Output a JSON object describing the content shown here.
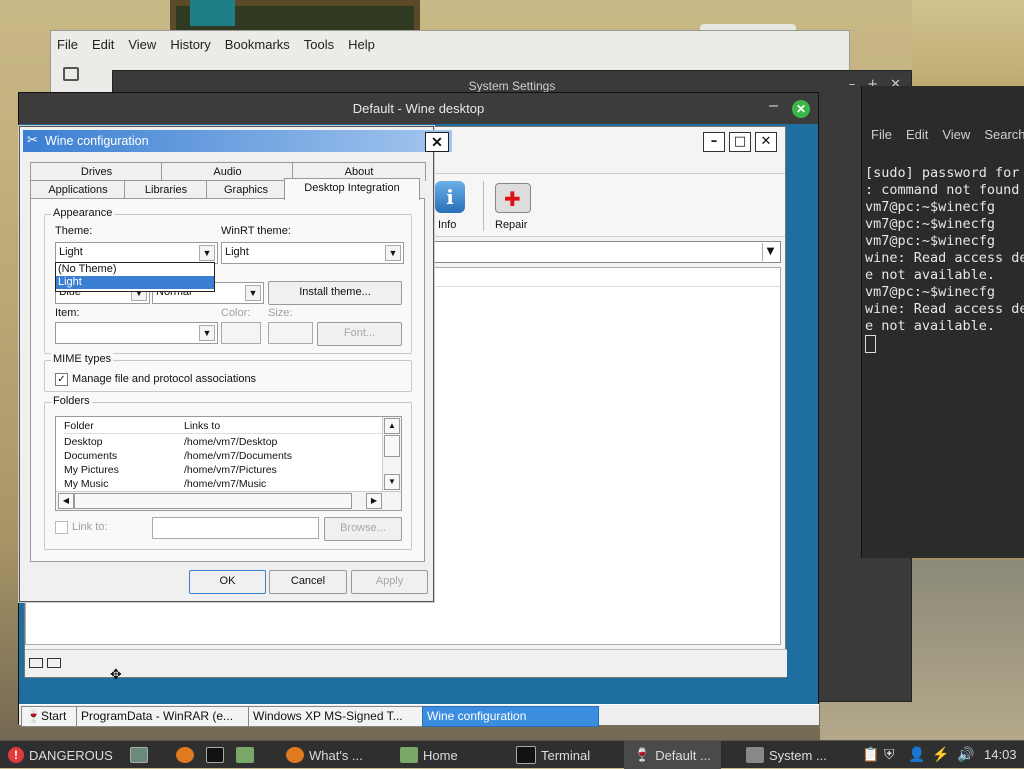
{
  "firefox": {
    "menu": [
      "File",
      "Edit",
      "View",
      "History",
      "Bookmarks",
      "Tools",
      "Help"
    ]
  },
  "system_settings": {
    "title": "System Settings",
    "controls": [
      "–",
      "+",
      "✕"
    ]
  },
  "terminal": {
    "menu": [
      "File",
      "Edit",
      "View",
      "Search"
    ],
    "lines": [
      "[sudo] password for",
      ": command not found",
      "vm7@pc:~$winecfg",
      "vm7@pc:~$winecfg",
      "vm7@pc:~$winecfg",
      "wine: Read access de",
      "e not available.",
      "vm7@pc:~$winecfg",
      "wine: Read access de",
      "e not available."
    ]
  },
  "wine_desktop": {
    "title": "Default - Wine desktop",
    "minimize": "–",
    "close": "✕"
  },
  "winrar": {
    "window_buttons": [
      "–",
      "□",
      "✕"
    ],
    "toolbar": [
      {
        "label": "Info",
        "icon": "info-icon"
      },
      {
        "label": "Repair",
        "icon": "first-aid-kit-icon"
      }
    ]
  },
  "winecfg": {
    "title": "Wine configuration",
    "close": "✕",
    "tabs_row1": [
      "Drives",
      "Audio",
      "About"
    ],
    "tabs_row2": [
      "Applications",
      "Libraries",
      "Graphics",
      "Desktop Integration"
    ],
    "appearance": {
      "group_label": "Appearance",
      "theme_label": "Theme:",
      "theme_value": "Light",
      "winrt_label": "WinRT theme:",
      "winrt_value": "Light",
      "theme_options": [
        "(No Theme)",
        "Light"
      ],
      "color_value": "Blue",
      "size_value": "Normal",
      "install_theme": "Install theme...",
      "item_label": "Item:",
      "color_label": "Color:",
      "size_label": "Size:",
      "font_button": "Font..."
    },
    "mime": {
      "group_label": "MIME types",
      "checkbox_label": "Manage file and protocol associations",
      "checked": true
    },
    "folders": {
      "group_label": "Folders",
      "headers": [
        "Folder",
        "Links to"
      ],
      "rows": [
        {
          "folder": "Desktop",
          "link": "/home/vm7/Desktop"
        },
        {
          "folder": "Documents",
          "link": "/home/vm7/Documents"
        },
        {
          "folder": "My Pictures",
          "link": "/home/vm7/Pictures"
        },
        {
          "folder": "My Music",
          "link": "/home/vm7/Music"
        }
      ],
      "link_to_label": "Link to:",
      "browse": "Browse..."
    },
    "buttons": {
      "ok": "OK",
      "cancel": "Cancel",
      "apply": "Apply"
    }
  },
  "wine_taskbar": [
    "Start",
    "ProgramData - WinRAR (e...",
    "Windows XP MS-Signed T...",
    "Wine configuration"
  ],
  "panel": {
    "items": [
      {
        "label": "DANGEROUS"
      },
      {
        "label": "What's ..."
      },
      {
        "label": "Home"
      },
      {
        "label": "Terminal"
      },
      {
        "label": "Default ..."
      },
      {
        "label": "System ..."
      }
    ],
    "clock": "14:03"
  }
}
